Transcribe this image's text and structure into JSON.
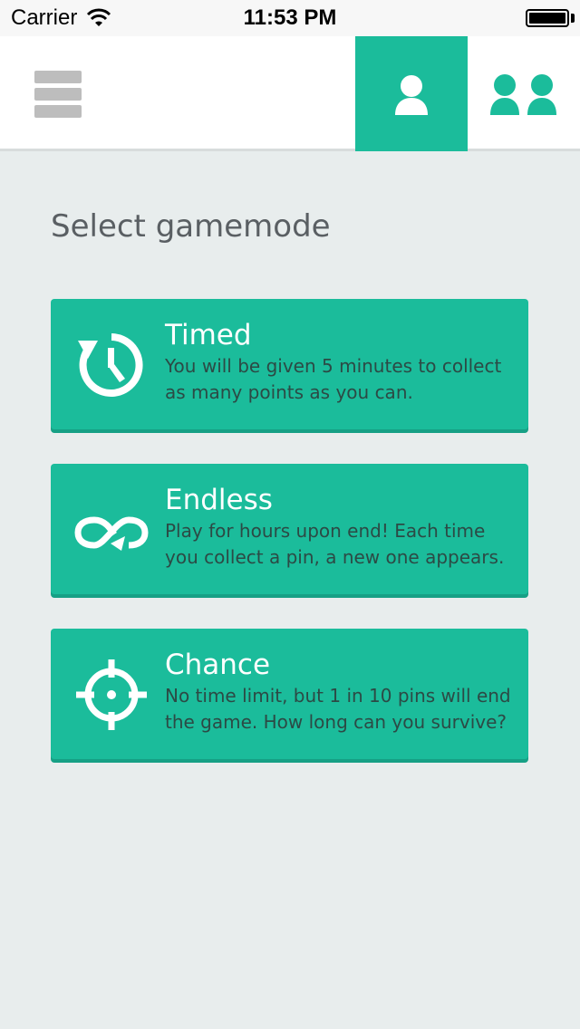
{
  "status_bar": {
    "carrier": "Carrier",
    "time": "11:53 PM"
  },
  "nav": {
    "menu_icon": "hamburger-menu-icon",
    "single_player_icon": "single-user-icon",
    "multi_player_icon": "two-users-icon",
    "active_tab": "single-player"
  },
  "colors": {
    "accent": "#1bbc9b",
    "background": "#e8eded",
    "title_text": "#5a5f63",
    "description_text": "#2c4a45"
  },
  "page": {
    "title": "Select gamemode"
  },
  "modes": [
    {
      "icon": "timer-icon",
      "title": "Timed",
      "description": "You will be given 5 minutes to collect as many points as you can."
    },
    {
      "icon": "infinity-loop-icon",
      "title": "Endless",
      "description": "Play for hours upon end! Each time you collect a pin, a new one appears."
    },
    {
      "icon": "crosshair-icon",
      "title": "Chance",
      "description": "No time limit, but 1 in 10 pins will end the game. How long can you survive?"
    }
  ]
}
